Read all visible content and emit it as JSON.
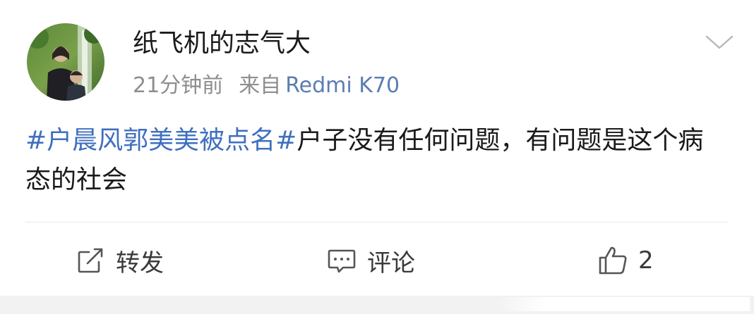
{
  "post": {
    "author": {
      "name": "纸飞机的志气大"
    },
    "meta": {
      "time": "21分钟前",
      "source_prefix": "来自",
      "device": "Redmi K70"
    },
    "content": {
      "topic": "#户晨风郭美美被点名#",
      "text": "户子没有任何问题，有问题是这个病态的社会"
    },
    "actions": {
      "repost_label": "转发",
      "comment_label": "评论",
      "like_count": "2"
    }
  },
  "icons": {
    "menu": "chevron-down-icon",
    "repost": "repost-icon",
    "comment": "comment-icon",
    "like": "thumbs-up-icon"
  },
  "colors": {
    "topic": "#3f6fbf",
    "device": "#5b7db1",
    "meta": "#8e8e8e",
    "text": "#1a1a1a"
  }
}
